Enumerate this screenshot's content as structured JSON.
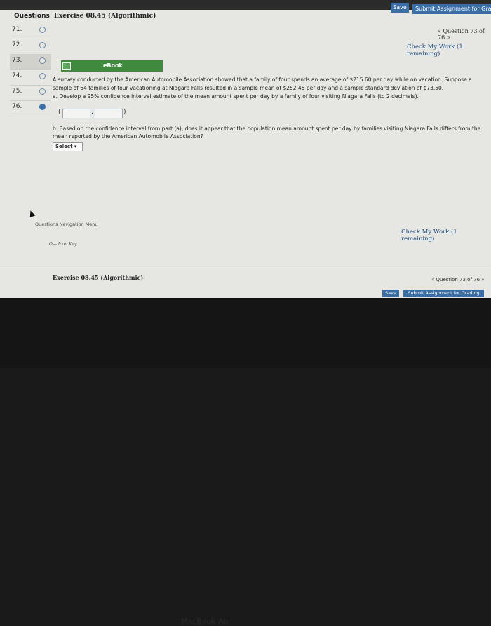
{
  "top": {
    "save": "Save",
    "submit": "Submit Assignment for Grading"
  },
  "headers": {
    "questions": "Questions",
    "exercise": "Exercise 08.45 (Algorithmic)"
  },
  "questions": [
    {
      "num": "71.",
      "filled": false,
      "selected": false
    },
    {
      "num": "72.",
      "filled": false,
      "selected": false
    },
    {
      "num": "73.",
      "filled": false,
      "selected": true
    },
    {
      "num": "74.",
      "filled": false,
      "selected": false
    },
    {
      "num": "75.",
      "filled": false,
      "selected": false
    },
    {
      "num": "76.",
      "filled": true,
      "selected": false
    }
  ],
  "counter": "« Question 73 of 76 »",
  "check_work": "Check My Work (1 remaining)",
  "ebook": "eBook",
  "problem": {
    "intro": "A survey conducted by the American Automobile Association showed that a family of four spends an average of $215.60 per day while on vacation. Suppose a sample of 64 families of four vacationing at Niagara Falls resulted in a sample mean of $252.45 per day and a sample standard deviation of $73.50.",
    "part_a": "a. Develop a 95% confidence interval estimate of the mean amount spent per day by a family of four visiting Niagara Falls (to 2 decimals).",
    "paren_open": "(",
    "comma": ",",
    "paren_close": ")",
    "part_b": "b. Based on the confidence interval from part (a), does it appear that the population mean amount spent per day by families visiting Niagara Falls differs from the mean reported by the American Automobile Association?",
    "select": "Select"
  },
  "bottom": {
    "nav_menu": "Questions Navigation Menu",
    "icon_key": "O— Icon Key",
    "check_work": "Check My Work (1 remaining)",
    "exercise": "Exercise 08.45 (Algorithmic)",
    "counter": "« Question 73 of 76 »",
    "save": "Save",
    "submit": "Submit Assignment for Grading"
  },
  "laptop_brand": "MacBook Air"
}
